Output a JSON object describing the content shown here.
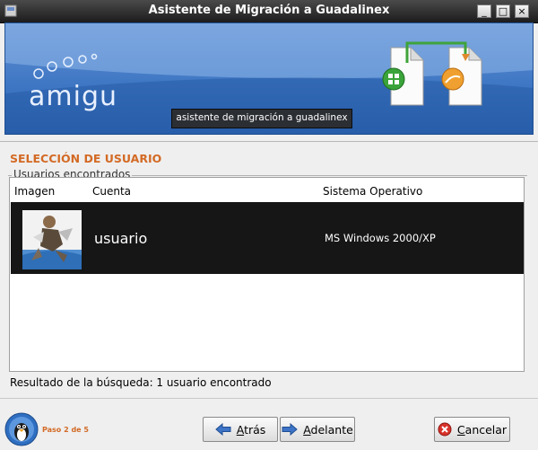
{
  "window": {
    "title": "Asistente de Migración a Guadalinex",
    "controls": [
      "_",
      "□",
      "×"
    ]
  },
  "banner": {
    "brand": "amigu",
    "tagline": "asistente de migración a guadalinex"
  },
  "section": {
    "title": "SELECCIÓN DE USUARIO",
    "group_label": "Usuarios encontrados"
  },
  "table": {
    "headers": [
      "Imagen",
      "Cuenta",
      "Sistema Operativo"
    ],
    "rows": [
      {
        "account": "usuario",
        "os": "MS Windows 2000/XP"
      }
    ]
  },
  "status": {
    "result": "Resultado de la búsqueda: 1 usuario encontrado"
  },
  "footer": {
    "step": "Paso 2 de 5",
    "back": {
      "first": "A",
      "rest": "trás"
    },
    "next": {
      "first": "A",
      "rest": "delante"
    },
    "cancel": {
      "first": "C",
      "rest": "ancelar"
    }
  },
  "colors": {
    "accent": "#d36a25",
    "banner": "#3f77c4",
    "selected_row": "#161616"
  }
}
